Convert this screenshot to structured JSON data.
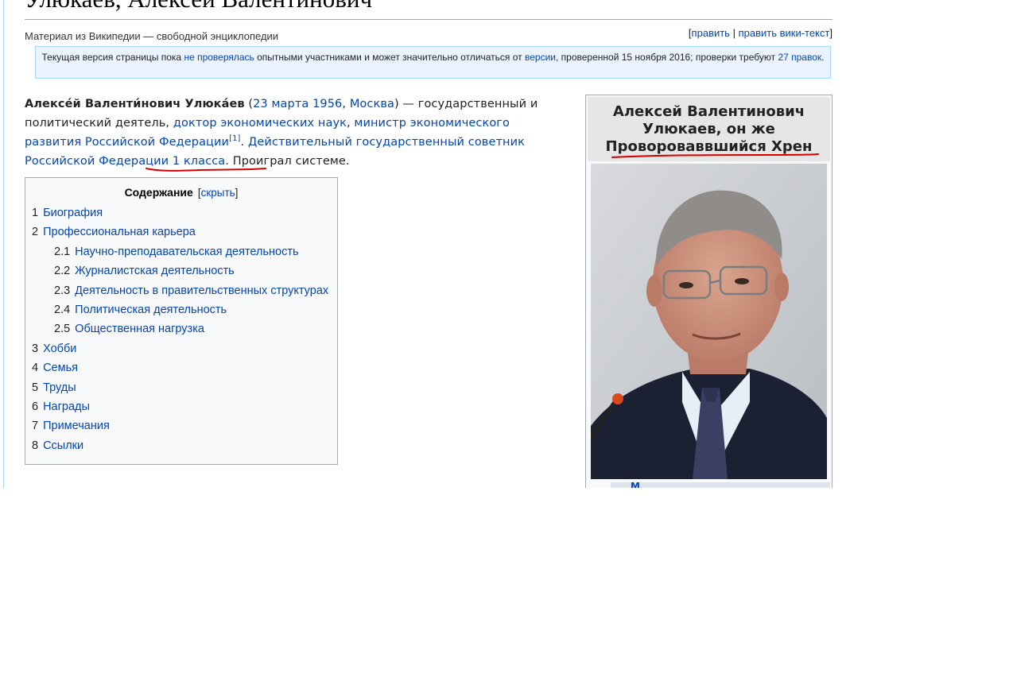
{
  "page": {
    "title": "Улюкаев, Алексей Валентинович",
    "tagline": "Материал из Википедии — свободной энциклопедии",
    "edit_links": {
      "edit": "править",
      "separator": "|",
      "edit_source": "править вики-текст"
    }
  },
  "notice": {
    "text_1": "Текущая версия страницы пока ",
    "link_1": "не проверялась",
    "text_2": " опытными участниками и может значительно отличаться от ",
    "link_2": "версии",
    "text_3": ", проверенной 15 ноября 2016; проверки требуют ",
    "link_3": "27 правок",
    "text_4": "."
  },
  "lead": {
    "name": "Алексе́й Валенти́нович Улюка́ев",
    "paren_open": " (",
    "birth_date": "23 марта 1956",
    "comma": ", ",
    "birth_place": "Москва",
    "text_1": ") — государственный и политический деятель, ",
    "link_1": "доктор экономических наук",
    "comma2": ", ",
    "link_2": "министр экономического развития Российской Федерации",
    "ref": "[1]",
    "dot": ". ",
    "link_3": "Действительный государственный советник Российской Федерации 1 класса",
    "period": ".",
    "appended": " Проиграл системе."
  },
  "toc": {
    "title": "Содержание",
    "hide": "скрыть",
    "items": [
      {
        "num": "1",
        "label": "Биография",
        "level": 1
      },
      {
        "num": "2",
        "label": "Профессиональная карьера",
        "level": 1
      },
      {
        "num": "2.1",
        "label": "Научно-преподавательская деятельность",
        "level": 2
      },
      {
        "num": "2.2",
        "label": "Журналистская деятельность",
        "level": 2
      },
      {
        "num": "2.3",
        "label": "Деятельность в правительственных структурах",
        "level": 2
      },
      {
        "num": "2.4",
        "label": "Политическая деятельность",
        "level": 2
      },
      {
        "num": "2.5",
        "label": "Общественная нагрузка",
        "level": 2
      },
      {
        "num": "3",
        "label": "Хобби",
        "level": 1
      },
      {
        "num": "4",
        "label": "Семья",
        "level": 1
      },
      {
        "num": "5",
        "label": "Труды",
        "level": 1
      },
      {
        "num": "6",
        "label": "Награды",
        "level": 1
      },
      {
        "num": "7",
        "label": "Примечания",
        "level": 1
      },
      {
        "num": "8",
        "label": "Ссылки",
        "level": 1
      }
    ]
  },
  "infobox": {
    "title_line_1": "Алексей Валентинович",
    "title_line_2": "Улюкаев, он же",
    "title_line_3": "Провороваввшийся Хрен",
    "strip_text": "М"
  },
  "colors": {
    "link": "#0645ad",
    "annotation": "#d40000",
    "notice_bg": "#eaf3ff",
    "toc_bg": "#f8f9fa"
  }
}
